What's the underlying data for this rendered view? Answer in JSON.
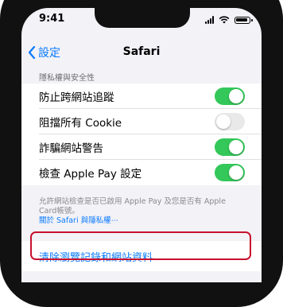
{
  "status": {
    "time": "9:41"
  },
  "nav": {
    "back_label": "設定",
    "title": "Safari"
  },
  "privacy": {
    "header": "隱私權與安全性",
    "rows": [
      {
        "label": "防止跨網站追蹤",
        "state": "on"
      },
      {
        "label": "阻擋所有 Cookie",
        "state": "off"
      },
      {
        "label": "詐騙網站警告",
        "state": "on"
      },
      {
        "label": "檢查 Apple Pay 設定",
        "state": "on"
      }
    ],
    "footer_line1": "允許網站檢查是否已啟用 Apple Pay 及您是否有 Apple",
    "footer_line2": "Card帳號。",
    "footer_link": "關於 Safari 與隱私權⋯"
  },
  "clear_history": {
    "label": "清除瀏覽記錄和網站資料"
  },
  "colors": {
    "accent": "#0a7aff",
    "toggle_on": "#34c759",
    "highlight": "#c8102e"
  }
}
